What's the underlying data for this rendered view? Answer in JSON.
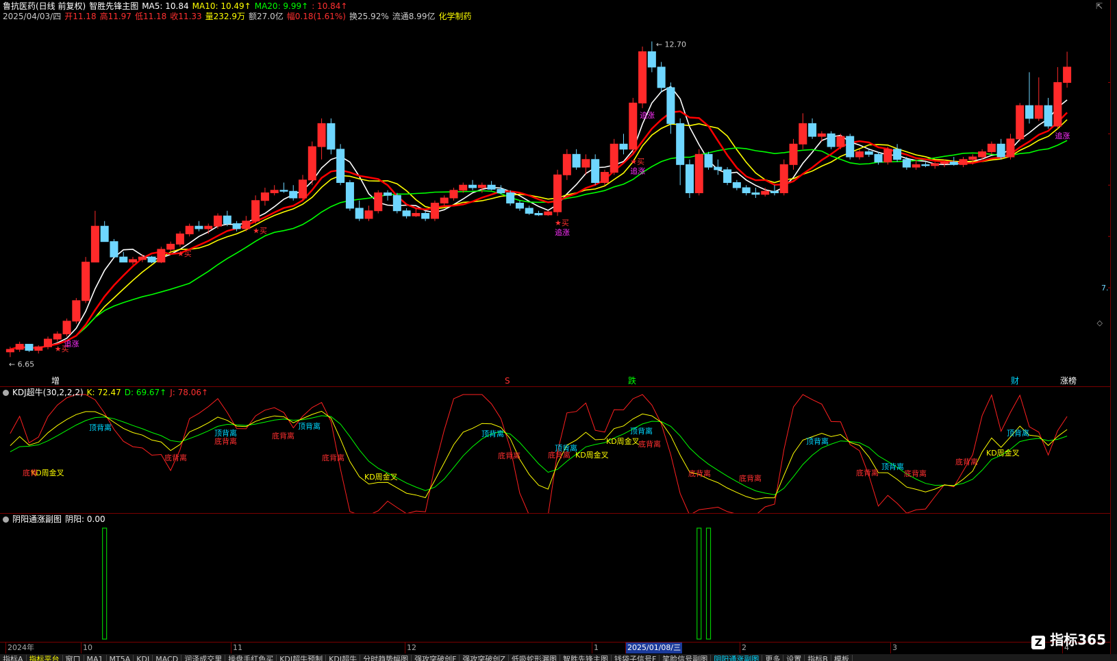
{
  "main_header": {
    "line1": [
      {
        "text": "鲁抗医药(日线 前复权)",
        "color": "#ffffff"
      },
      {
        "text": "智胜先锋主图",
        "color": "#ffffff"
      },
      {
        "text": "MA5: 10.84",
        "color": "#ffffff"
      },
      {
        "text": "MA10: 10.49↑",
        "color": "#ffff00"
      },
      {
        "text": "MA20: 9.99↑",
        "color": "#00ff00"
      },
      {
        "text": ": 10.84↑",
        "color": "#ff3030"
      }
    ],
    "line2": [
      {
        "text": "2025/04/03/四",
        "color": "#cccccc"
      },
      {
        "text": "开11.18",
        "color": "#ff3030"
      },
      {
        "text": "高11.97",
        "color": "#ff3030"
      },
      {
        "text": "低11.18",
        "color": "#ff3030"
      },
      {
        "text": "收11.33",
        "color": "#ff3030"
      },
      {
        "text": "量232.9万",
        "color": "#ffff00"
      },
      {
        "text": "额27.0亿",
        "color": "#cccccc"
      },
      {
        "text": "幅0.18(1.61%)",
        "color": "#ff3030"
      },
      {
        "text": "换25.92%",
        "color": "#cccccc"
      },
      {
        "text": "流通8.99亿",
        "color": "#cccccc"
      },
      {
        "text": "化学制药",
        "color": "#ffff00"
      }
    ]
  },
  "price": {
    "max_label": "12.70",
    "min_label": "6.65",
    "right_edge_label": "7."
  },
  "chart_data": {
    "type": "candlestick",
    "ylim": [
      6.4,
      13.1
    ],
    "candles": [
      [
        6.75,
        6.85,
        6.65,
        6.8
      ],
      [
        6.8,
        6.95,
        6.75,
        6.9
      ],
      [
        6.9,
        6.9,
        6.75,
        6.78
      ],
      [
        6.78,
        6.88,
        6.72,
        6.85
      ],
      [
        6.85,
        7.05,
        6.8,
        7.0
      ],
      [
        7.0,
        7.15,
        6.95,
        7.1
      ],
      [
        7.1,
        7.4,
        7.05,
        7.35
      ],
      [
        7.35,
        7.8,
        7.3,
        7.75
      ],
      [
        7.75,
        8.6,
        7.7,
        8.5
      ],
      [
        8.5,
        9.5,
        8.5,
        9.2
      ],
      [
        9.2,
        9.3,
        8.9,
        8.9
      ],
      [
        8.9,
        8.95,
        8.6,
        8.6
      ],
      [
        8.6,
        8.7,
        8.5,
        8.5
      ],
      [
        8.5,
        8.6,
        8.45,
        8.55
      ],
      [
        8.55,
        8.65,
        8.5,
        8.6
      ],
      [
        8.6,
        8.62,
        8.48,
        8.5
      ],
      [
        8.5,
        8.8,
        8.48,
        8.75
      ],
      [
        8.75,
        8.9,
        8.7,
        8.85
      ],
      [
        8.85,
        9.1,
        8.8,
        9.05
      ],
      [
        9.05,
        9.25,
        9.0,
        9.2
      ],
      [
        9.2,
        9.3,
        9.1,
        9.15
      ],
      [
        9.15,
        9.25,
        9.05,
        9.2
      ],
      [
        9.2,
        9.45,
        9.15,
        9.4
      ],
      [
        9.4,
        9.5,
        9.2,
        9.25
      ],
      [
        9.25,
        9.3,
        9.1,
        9.15
      ],
      [
        9.15,
        9.4,
        9.1,
        9.3
      ],
      [
        9.3,
        9.8,
        9.25,
        9.7
      ],
      [
        9.7,
        9.95,
        9.6,
        9.85
      ],
      [
        9.85,
        10.0,
        9.8,
        9.9
      ],
      [
        9.9,
        10.05,
        9.85,
        9.88
      ],
      [
        9.88,
        10.0,
        9.7,
        9.75
      ],
      [
        9.75,
        10.2,
        9.7,
        10.1
      ],
      [
        10.1,
        10.85,
        10.0,
        10.75
      ],
      [
        10.75,
        11.3,
        10.5,
        11.2
      ],
      [
        11.2,
        11.3,
        10.6,
        10.7
      ],
      [
        10.7,
        10.8,
        10.0,
        10.05
      ],
      [
        10.05,
        10.1,
        9.5,
        9.55
      ],
      [
        9.55,
        9.7,
        9.3,
        9.35
      ],
      [
        9.35,
        9.6,
        9.3,
        9.5
      ],
      [
        9.5,
        9.9,
        9.45,
        9.85
      ],
      [
        9.85,
        9.9,
        9.7,
        9.8
      ],
      [
        9.8,
        9.85,
        9.45,
        9.5
      ],
      [
        9.5,
        9.55,
        9.35,
        9.4
      ],
      [
        9.4,
        9.55,
        9.38,
        9.45
      ],
      [
        9.45,
        9.5,
        9.3,
        9.35
      ],
      [
        9.35,
        9.7,
        9.3,
        9.65
      ],
      [
        9.65,
        9.8,
        9.6,
        9.75
      ],
      [
        9.75,
        9.95,
        9.7,
        9.9
      ],
      [
        9.9,
        10.05,
        9.85,
        10.0
      ],
      [
        10.0,
        10.1,
        9.9,
        9.95
      ],
      [
        9.95,
        10.05,
        9.85,
        10.0
      ],
      [
        10.0,
        10.08,
        9.9,
        9.92
      ],
      [
        9.92,
        10.0,
        9.82,
        9.85
      ],
      [
        9.85,
        9.9,
        9.6,
        9.65
      ],
      [
        9.65,
        9.7,
        9.5,
        9.55
      ],
      [
        9.55,
        9.6,
        9.42,
        9.45
      ],
      [
        9.45,
        9.5,
        9.4,
        9.42
      ],
      [
        9.42,
        9.5,
        9.4,
        9.48
      ],
      [
        9.48,
        10.3,
        9.4,
        10.2
      ],
      [
        10.2,
        10.7,
        10.1,
        10.6
      ],
      [
        10.6,
        10.7,
        10.3,
        10.35
      ],
      [
        10.35,
        10.6,
        10.2,
        10.5
      ],
      [
        10.5,
        10.6,
        10.0,
        10.05
      ],
      [
        10.05,
        10.3,
        10.0,
        10.25
      ],
      [
        10.25,
        10.9,
        10.2,
        10.8
      ],
      [
        10.8,
        11.0,
        10.6,
        10.7
      ],
      [
        10.7,
        11.7,
        10.6,
        11.6
      ],
      [
        11.6,
        12.7,
        11.5,
        12.6
      ],
      [
        12.6,
        12.8,
        12.2,
        12.3
      ],
      [
        12.3,
        12.4,
        11.8,
        11.9
      ],
      [
        11.9,
        12.0,
        11.0,
        11.2
      ],
      [
        11.2,
        11.3,
        10.0,
        10.4
      ],
      [
        10.4,
        10.5,
        9.75,
        9.85
      ],
      [
        9.85,
        10.7,
        9.8,
        10.6
      ],
      [
        10.6,
        10.65,
        10.3,
        10.35
      ],
      [
        10.35,
        10.5,
        10.2,
        10.3
      ],
      [
        10.3,
        10.35,
        10.0,
        10.05
      ],
      [
        10.05,
        10.1,
        9.9,
        9.95
      ],
      [
        9.95,
        10.0,
        9.8,
        9.85
      ],
      [
        9.85,
        9.95,
        9.75,
        9.82
      ],
      [
        9.82,
        9.95,
        9.78,
        9.88
      ],
      [
        9.88,
        10.0,
        9.8,
        9.85
      ],
      [
        9.85,
        10.5,
        9.8,
        10.4
      ],
      [
        10.4,
        10.9,
        10.3,
        10.8
      ],
      [
        10.8,
        11.4,
        10.7,
        11.2
      ],
      [
        11.2,
        11.3,
        10.9,
        10.95
      ],
      [
        10.95,
        11.05,
        10.85,
        11.0
      ],
      [
        11.0,
        11.05,
        10.7,
        10.75
      ],
      [
        10.75,
        11.0,
        10.7,
        10.95
      ],
      [
        10.95,
        11.0,
        10.5,
        10.55
      ],
      [
        10.55,
        10.7,
        10.5,
        10.65
      ],
      [
        10.65,
        10.7,
        10.55,
        10.6
      ],
      [
        10.6,
        10.65,
        10.4,
        10.45
      ],
      [
        10.45,
        10.75,
        10.4,
        10.7
      ],
      [
        10.7,
        10.8,
        10.45,
        10.5
      ],
      [
        10.5,
        10.55,
        10.3,
        10.35
      ],
      [
        10.35,
        10.5,
        10.3,
        10.4
      ],
      [
        10.4,
        10.45,
        10.35,
        10.38
      ],
      [
        10.38,
        10.45,
        10.32,
        10.42
      ],
      [
        10.42,
        10.5,
        10.35,
        10.45
      ],
      [
        10.45,
        10.55,
        10.38,
        10.4
      ],
      [
        10.4,
        10.55,
        10.35,
        10.5
      ],
      [
        10.5,
        10.6,
        10.4,
        10.55
      ],
      [
        10.55,
        10.7,
        10.5,
        10.65
      ],
      [
        10.65,
        10.85,
        10.6,
        10.8
      ],
      [
        10.8,
        10.9,
        10.5,
        10.55
      ],
      [
        10.55,
        11.0,
        10.5,
        10.9
      ],
      [
        10.9,
        11.6,
        10.85,
        11.55
      ],
      [
        11.55,
        12.2,
        11.2,
        11.3
      ],
      [
        11.3,
        12.1,
        11.25,
        11.55
      ],
      [
        11.55,
        11.7,
        11.1,
        11.15
      ],
      [
        11.15,
        12.3,
        11.1,
        12.0
      ],
      [
        12.0,
        12.6,
        11.9,
        12.3
      ]
    ],
    "ma_series": [
      {
        "name": "MA5",
        "color": "#ffffff"
      },
      {
        "name": "MA10",
        "color": "#ffff00"
      },
      {
        "name": "MA20",
        "color": "#00ff00"
      },
      {
        "name": "",
        "color": "#ff0000"
      }
    ]
  },
  "signals": [
    {
      "idx": 5,
      "label": "★买",
      "color": "#ff3030"
    },
    {
      "idx": 6,
      "label": "追涨",
      "color": "#ff30ff"
    },
    {
      "idx": 18,
      "label": "★买",
      "color": "#ff3030"
    },
    {
      "idx": 26,
      "label": "★买",
      "color": "#ff3030"
    },
    {
      "idx": 58,
      "label": "★买",
      "color": "#ff3030"
    },
    {
      "idx": 58,
      "label": "追涨",
      "color": "#ff30ff"
    },
    {
      "idx": 66,
      "label": "★买",
      "color": "#ff3030"
    },
    {
      "idx": 66,
      "label": "追涨",
      "color": "#ff30ff"
    },
    {
      "idx": 67,
      "label": "追涨",
      "color": "#ff30ff"
    },
    {
      "idx": 111,
      "label": "追涨",
      "color": "#ff30ff"
    },
    {
      "idx": 115,
      "label": "追涨",
      "color": "#ff30ff"
    }
  ],
  "bottom_markers": [
    {
      "text": "增",
      "color": "#ffffff",
      "x": 75
    },
    {
      "text": "S",
      "color": "#ff3030",
      "x": 737
    },
    {
      "text": "跌",
      "color": "#00ff00",
      "x": 917
    },
    {
      "text": "财",
      "color": "#00d8ff",
      "x": 1476
    },
    {
      "text": "涨榜",
      "color": "#ffffff",
      "x": 1548
    }
  ],
  "kdj": {
    "header_title": "KDJ超牛(30,2,2,2)",
    "k_label": "K: 72.47",
    "d_label": "D: 69.67↑",
    "j_label": "J: 78.06↑",
    "annotations": [
      {
        "text": "KD周金叉",
        "color": "#ffff00",
        "x": 45,
        "y": 130
      },
      {
        "text": "底背",
        "color": "#ff3030",
        "x": 33,
        "y": 130
      },
      {
        "text": "顶背离",
        "color": "#00d8ff",
        "x": 130,
        "y": 64
      },
      {
        "text": "底背离",
        "color": "#ff3030",
        "x": 240,
        "y": 108
      },
      {
        "text": "顶背离",
        "color": "#00d8ff",
        "x": 313,
        "y": 72
      },
      {
        "text": "底背离",
        "color": "#ff3030",
        "x": 313,
        "y": 84
      },
      {
        "text": "底背离",
        "color": "#ff3030",
        "x": 397,
        "y": 76
      },
      {
        "text": "顶背离",
        "color": "#00d8ff",
        "x": 435,
        "y": 62
      },
      {
        "text": "底背离",
        "color": "#ff3030",
        "x": 470,
        "y": 108
      },
      {
        "text": "KD周金叉",
        "color": "#ffff00",
        "x": 532,
        "y": 136
      },
      {
        "text": "顶背离",
        "color": "#00d8ff",
        "x": 703,
        "y": 73
      },
      {
        "text": "底背离",
        "color": "#ff3030",
        "x": 727,
        "y": 105
      },
      {
        "text": "顶背离",
        "color": "#00d8ff",
        "x": 810,
        "y": 94
      },
      {
        "text": "底背离",
        "color": "#ff3030",
        "x": 800,
        "y": 104
      },
      {
        "text": "KD周金叉",
        "color": "#ffff00",
        "x": 840,
        "y": 104
      },
      {
        "text": "KD周金叉",
        "color": "#ffff00",
        "x": 885,
        "y": 84
      },
      {
        "text": "顶背离",
        "color": "#00d8ff",
        "x": 920,
        "y": 69
      },
      {
        "text": "底背离",
        "color": "#ff3030",
        "x": 932,
        "y": 88
      },
      {
        "text": "底背离",
        "color": "#ff3030",
        "x": 1005,
        "y": 131
      },
      {
        "text": "底背离",
        "color": "#ff3030",
        "x": 1079,
        "y": 138
      },
      {
        "text": "顶背离",
        "color": "#00d8ff",
        "x": 1177,
        "y": 84
      },
      {
        "text": "底背离",
        "color": "#ff3030",
        "x": 1250,
        "y": 130
      },
      {
        "text": "顶背离",
        "color": "#00d8ff",
        "x": 1287,
        "y": 121
      },
      {
        "text": "底背离",
        "color": "#ff3030",
        "x": 1320,
        "y": 131
      },
      {
        "text": "底背离",
        "color": "#ff3030",
        "x": 1395,
        "y": 114
      },
      {
        "text": "KD周金叉",
        "color": "#ffff00",
        "x": 1440,
        "y": 101
      },
      {
        "text": "顶背离",
        "color": "#00d8ff",
        "x": 1470,
        "y": 72
      }
    ]
  },
  "yinyang": {
    "header_title": "阴阳通涨副图",
    "value_label": "阴阳: 0.00",
    "spikes": [
      10,
      73,
      74
    ]
  },
  "time_axis": [
    {
      "text": "2024年",
      "x": 8
    },
    {
      "text": "10",
      "x": 118
    },
    {
      "text": "11",
      "x": 337
    },
    {
      "text": "12",
      "x": 591
    },
    {
      "text": "1",
      "x": 864
    },
    {
      "text": "2025/01/08/三",
      "x": 913,
      "highlight": true
    },
    {
      "text": "2",
      "x": 1080
    },
    {
      "text": "3",
      "x": 1300
    },
    {
      "text": "4",
      "x": 1551
    }
  ],
  "watermark": "指标365",
  "tabs": [
    {
      "label": "指标A",
      "active": false
    },
    {
      "label": "指标平台",
      "active": false,
      "color": "#ffff00"
    },
    {
      "label": "窗口",
      "active": false
    },
    {
      "label": "MA1",
      "active": false
    },
    {
      "label": "MT5A",
      "active": false
    },
    {
      "label": "KDJ",
      "active": false
    },
    {
      "label": "MACD",
      "active": false
    },
    {
      "label": "润泽成交里",
      "active": false
    },
    {
      "label": "操盘手红色买",
      "active": false
    },
    {
      "label": "KDJ超牛预制",
      "active": false
    },
    {
      "label": "KDJ超牛",
      "active": false
    },
    {
      "label": "分时趋势幅图",
      "active": false
    },
    {
      "label": "强攻突破创F",
      "active": false
    },
    {
      "label": "强攻突破创Z",
      "active": false
    },
    {
      "label": "低吸蛇形漏图",
      "active": false
    },
    {
      "label": "智胜先锋主图",
      "active": false
    },
    {
      "label": "钱袋子信号F",
      "active": false
    },
    {
      "label": "笑脸信号副图",
      "active": false
    },
    {
      "label": "阴阳通涨副图",
      "active": true
    },
    {
      "label": "更多",
      "active": false
    },
    {
      "label": "设置",
      "active": false
    },
    {
      "label": "指标B",
      "active": false
    },
    {
      "label": "模板",
      "active": false
    }
  ]
}
